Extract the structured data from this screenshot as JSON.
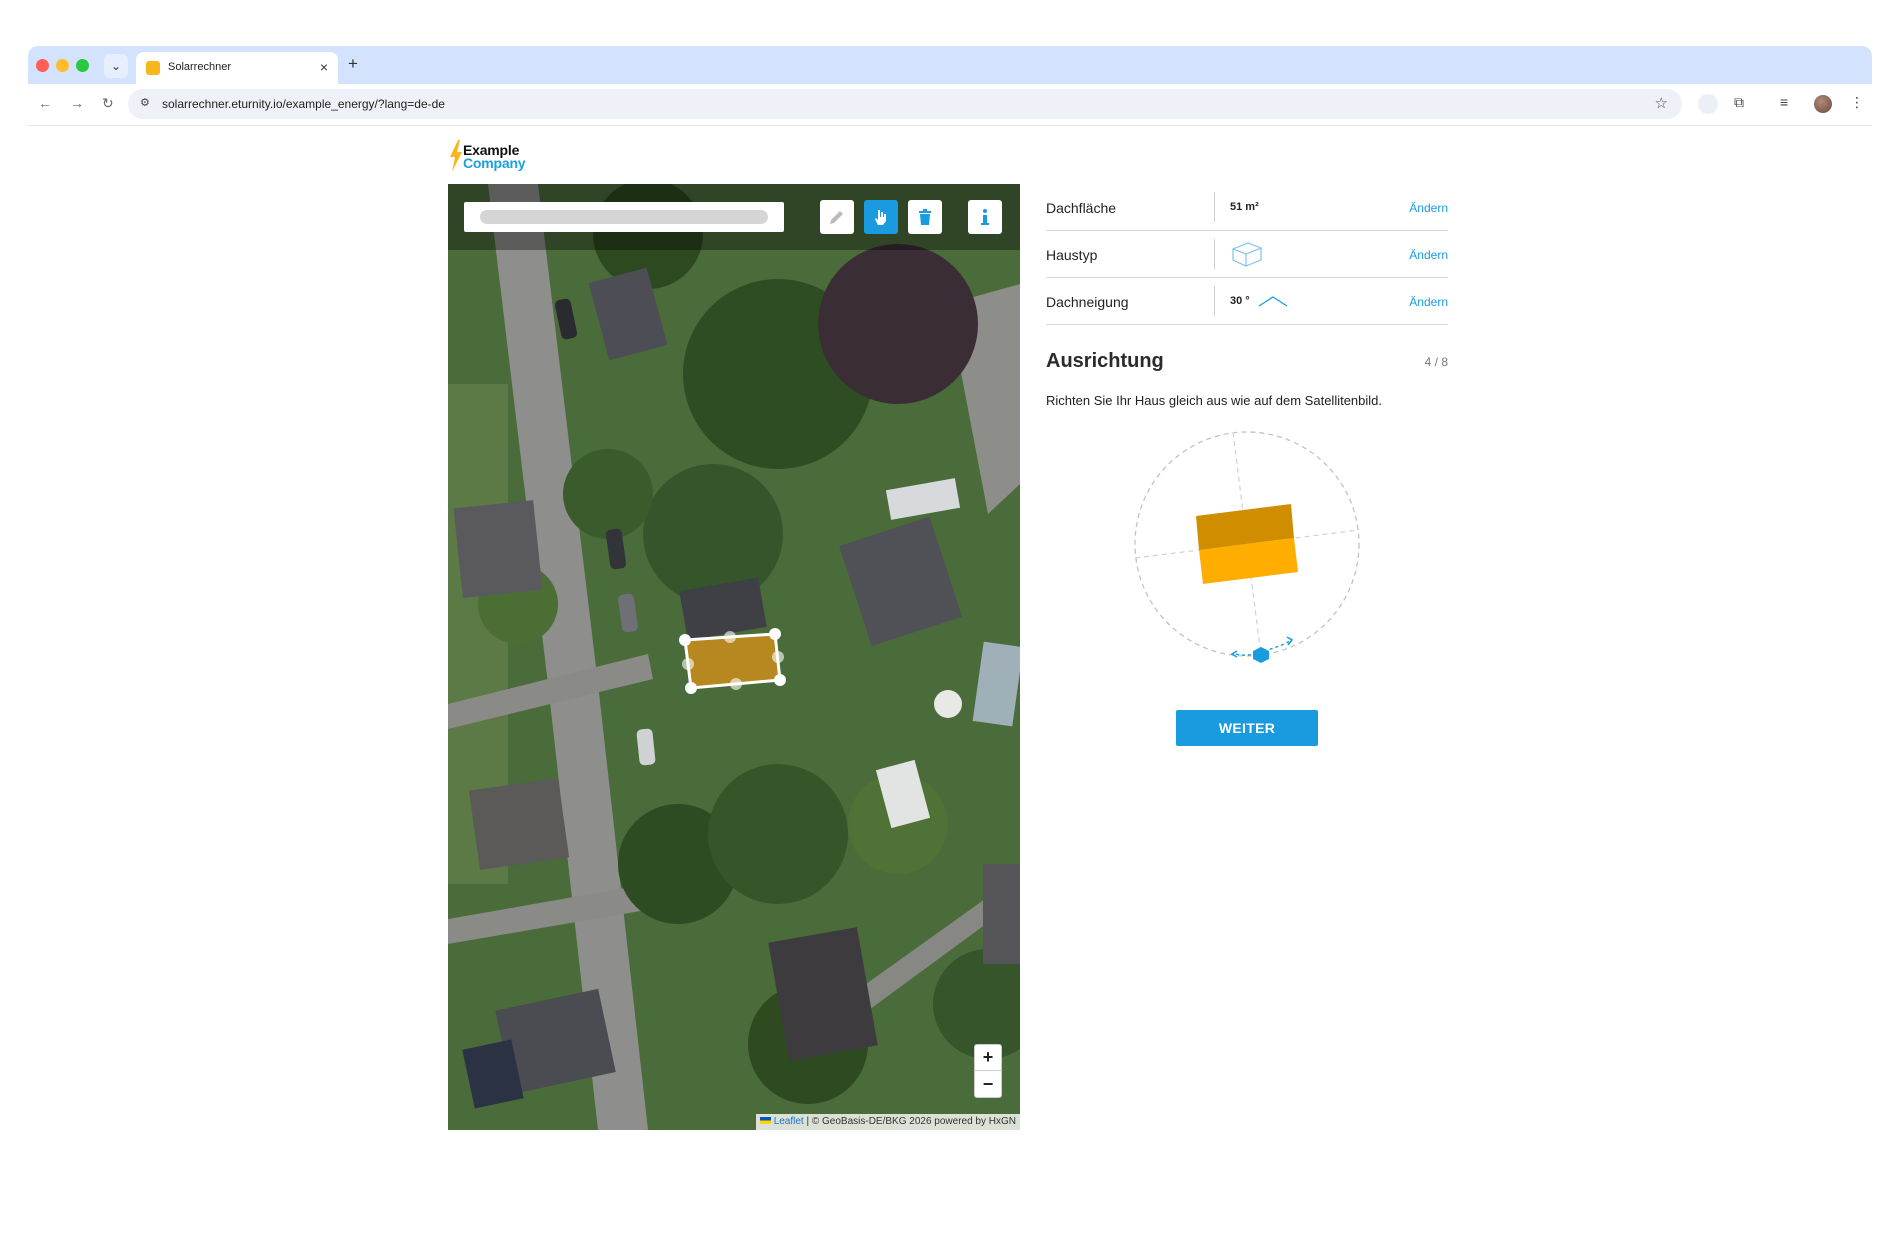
{
  "browser": {
    "tab_title": "Solarrechner",
    "new_tab": "+",
    "tab_close": "×",
    "url": "solarrechner.eturnity.io/example_energy/?lang=de-de"
  },
  "logo": {
    "line1": "Example",
    "line2": "Company"
  },
  "map": {
    "zoom_in": "+",
    "zoom_out": "−",
    "attribution_link": "Leaflet",
    "attribution_text": " | © GeoBasis-DE/BKG 2026 powered by HxGN"
  },
  "summary": {
    "rows": [
      {
        "label": "Dachfläche",
        "value": "51 m²",
        "change": "Ändern"
      },
      {
        "label": "Haustyp",
        "value": "",
        "change": "Ändern"
      },
      {
        "label": "Dachneigung",
        "value": "30 °",
        "change": "Ändern"
      }
    ]
  },
  "section": {
    "title": "Ausrichtung",
    "step": "4 / 8",
    "description": "Richten Sie Ihr Haus gleich aus wie auf dem Satellitenbild."
  },
  "actions": {
    "next": "WEITER"
  },
  "colors": {
    "accent": "#1a9be0",
    "roof_dark": "#d08d00",
    "roof_light": "#ffad00"
  }
}
